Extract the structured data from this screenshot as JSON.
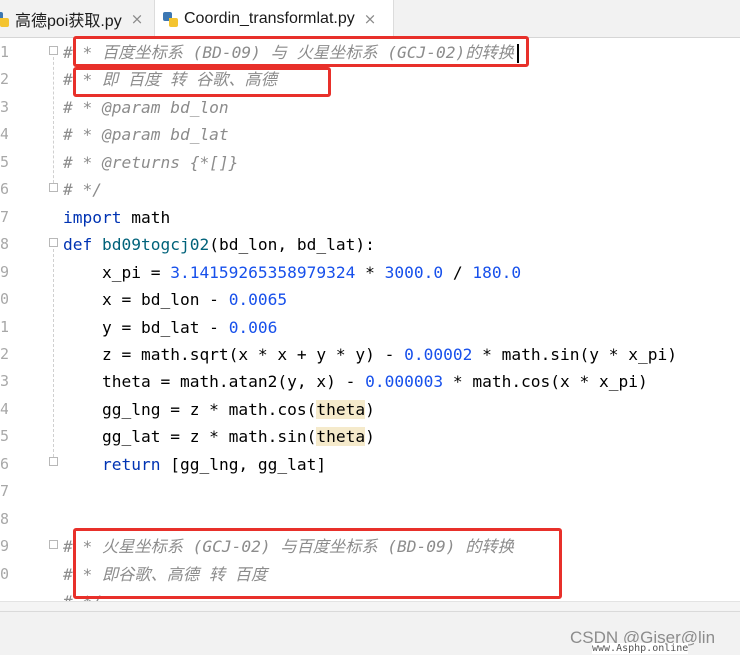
{
  "tabs": [
    {
      "label": "高德poi获取.py",
      "close": "×"
    },
    {
      "label": "Coordin_transformlat.py",
      "close": "×"
    }
  ],
  "line_numbers": [
    "1",
    "2",
    "3",
    "4",
    "5",
    "6",
    "7",
    "8",
    "9",
    "0",
    "1",
    "2",
    "3",
    "4",
    "5",
    "6",
    "7",
    "8",
    "9",
    "0"
  ],
  "code": {
    "l1": {
      "hash": "#",
      "text": " * 百度坐标系 (BD-09) 与 火星坐标系 (GCJ-02)的转换"
    },
    "l2": {
      "hash": "#",
      "text": " * 即 百度 转 谷歌、高德"
    },
    "l3": "# * @param bd_lon",
    "l4": "# * @param bd_lat",
    "l5": "# * @returns {*[]}",
    "l6": "# */",
    "l7": {
      "kw": "import",
      "rest": " math"
    },
    "l8": {
      "kw": "def",
      "fn": "bd09togcj02",
      "rest": "(bd_lon, bd_lat):"
    },
    "l9": {
      "a": "    x_pi = ",
      "n1": "3.14159265358979324",
      "b": " * ",
      "n2": "3000.0",
      "c": " / ",
      "n3": "180.0"
    },
    "l10": {
      "a": "    x = bd_lon - ",
      "n1": "0.0065"
    },
    "l11": {
      "a": "    y = bd_lat - ",
      "n1": "0.006"
    },
    "l12": {
      "a": "    z = math.sqrt(x * x + y * y) - ",
      "n1": "0.00002",
      "b": " * math.sin(y * x_pi)"
    },
    "l13": {
      "a": "    theta = math.atan2(y, x) - ",
      "n1": "0.000003",
      "b": " * math.cos(x * x_pi)"
    },
    "l14": {
      "a": "    gg_lng = z * math.cos(",
      "hl": "theta",
      "b": ")"
    },
    "l15": {
      "a": "    gg_lat = z * math.sin(",
      "hl": "theta",
      "b": ")"
    },
    "l16": {
      "kw": "return",
      "rest": " [gg_lng, gg_lat]"
    },
    "l19": {
      "hash": "#",
      "text": " * 火星坐标系 (GCJ-02) 与百度坐标系 (BD-09) 的转换"
    },
    "l20": {
      "hash": "#",
      "text": " * 即谷歌、高德 转 百度"
    },
    "l21": "# */"
  },
  "watermark": {
    "csdn": "CSDN @Giser@lin",
    "site": "www.Asphp.online"
  },
  "colors": {
    "comment": "#8c8c8c",
    "keyword": "#0033b3",
    "number": "#1750eb",
    "highlight_box": "#e8302a",
    "tab_accent": "#4a86e8"
  }
}
